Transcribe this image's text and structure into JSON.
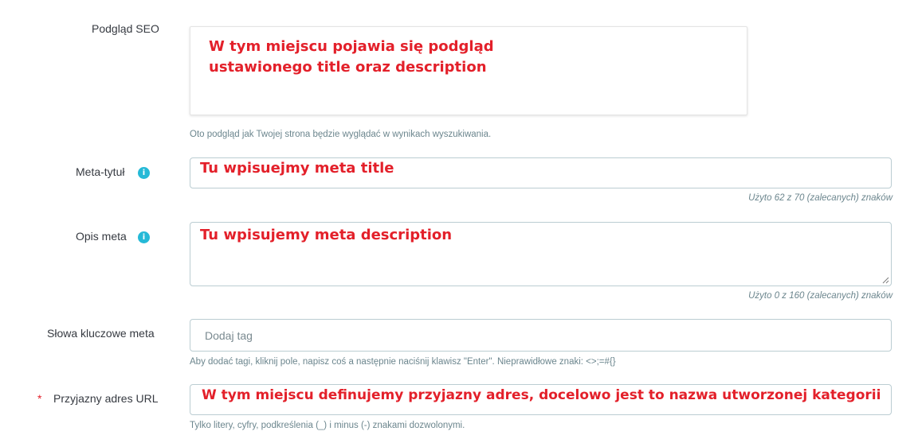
{
  "seo_preview": {
    "label": "Podgląd SEO",
    "annotation_line1": "W tym miejscu pojawia się podgląd",
    "annotation_line2": "ustawionego title oraz description",
    "help": "Oto podgląd jak Twojej strona będzie wyglądać w wynikach wyszukiwania."
  },
  "meta_title": {
    "label": "Meta-tytuł",
    "value": "Tu wpisuejmy meta title",
    "counter": "Użyto 62 z 70 (zalecanych) znaków"
  },
  "meta_description": {
    "label": "Opis meta",
    "value": "Tu wpisujemy meta description",
    "counter": "Użyto 0 z 160 (zalecanych) znaków"
  },
  "meta_keywords": {
    "label": "Słowa kluczowe meta",
    "placeholder": "Dodaj tag",
    "help": "Aby dodać tagi, kliknij pole, napisz coś a następnie naciśnij klawisz \"Enter\". Nieprawidłowe znaki: <>;=#{}"
  },
  "friendly_url": {
    "required_mark": "*",
    "label": "Przyjazny adres URL",
    "value": "W tym miejscu definujemy przyjazny adres, docelowo jest to nazwa utworzonej kategorii",
    "help": "Tylko litery, cyfry, podkreślenia (_) i minus (-) znakami dozwolonymi."
  },
  "icons": {
    "info": "i"
  },
  "colors": {
    "annotation": "#e3202a",
    "info_icon": "#25b9d7",
    "border": "#bbcdd2",
    "help_text": "#6c868e"
  }
}
